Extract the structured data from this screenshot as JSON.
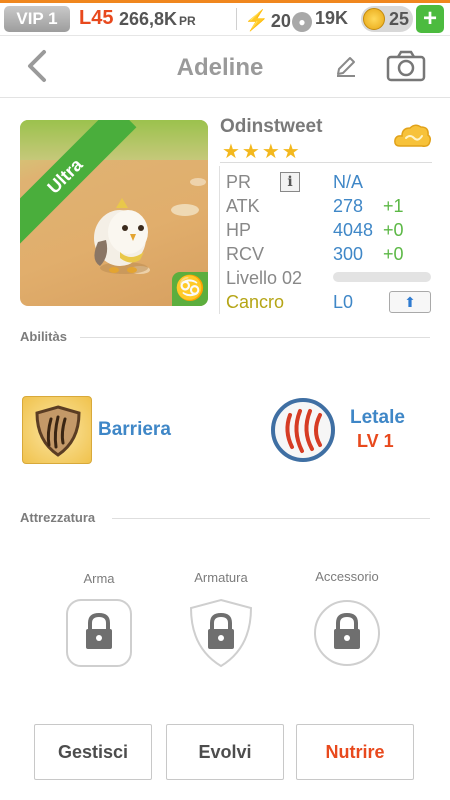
{
  "status_bar": {
    "vip": "VIP 1",
    "level": "L45",
    "coins": "266,8K",
    "coins_unit": "PR",
    "energy": "20",
    "paw_points": "19K",
    "gold": "25",
    "plus_label": "+",
    "accent_color": "#f0871e"
  },
  "header": {
    "title": "Adeline",
    "back_icon": "chevron-left-icon",
    "edit_icon": "pencil-icon",
    "camera_icon": "camera-icon"
  },
  "pet": {
    "rarity": "Ultra",
    "name": "Odinstweet",
    "stars": "★★★★",
    "star_count": 4,
    "element_icon": "cloud-icon",
    "zodiac_symbol": "♋",
    "stats": {
      "pr_label": "PR",
      "pr_info_icon": "i",
      "pr_value": "N/A",
      "atk_label": "ATK",
      "atk_value": "278",
      "atk_bonus": "+1",
      "hp_label": "HP",
      "hp_value": "4048",
      "hp_bonus": "+0",
      "rcv_label": "RCV",
      "rcv_value": "300",
      "rcv_bonus": "+0",
      "level_label": "Livello 02",
      "level_progress": 0.0,
      "sign_label": "Cancro",
      "sign_level": "L0",
      "upgrade_icon": "⬆"
    }
  },
  "abilities": {
    "section_label": "Abilitàs",
    "skills": [
      {
        "name": "Barriera",
        "icon": "shield-claw-icon"
      },
      {
        "name": "Letale",
        "level": "LV 1",
        "icon": "claw-slash-icon"
      }
    ]
  },
  "equipment": {
    "section_label": "Attrezzatura",
    "slots": [
      {
        "label": "Arma",
        "icon": "lock-icon"
      },
      {
        "label": "Armatura",
        "icon": "lock-icon"
      },
      {
        "label": "Accessorio",
        "icon": "lock-icon"
      }
    ]
  },
  "actions": {
    "manage": "Gestisci",
    "evolve": "Evolvi",
    "feed": "Nutrire",
    "feed_color": "#e8491d"
  }
}
